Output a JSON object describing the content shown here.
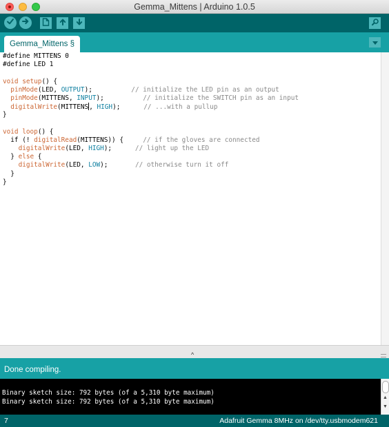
{
  "window": {
    "title": "Gemma_Mittens | Arduino 1.0.5"
  },
  "toolbar": {
    "buttons": [
      "verify-icon",
      "upload-icon",
      "new-icon",
      "open-icon",
      "save-icon",
      "serial-monitor-icon"
    ]
  },
  "tabs": [
    {
      "label": "Gemma_Mittens §"
    }
  ],
  "editor": {
    "lines": [
      [
        {
          "t": "#define MITTENS 0",
          "c": ""
        }
      ],
      [
        {
          "t": "#define LED 1",
          "c": ""
        }
      ],
      [],
      [
        {
          "t": "void",
          "c": "kw"
        },
        {
          "t": " ",
          "c": ""
        },
        {
          "t": "setup",
          "c": "kw"
        },
        {
          "t": "() {",
          "c": ""
        }
      ],
      [
        {
          "t": "  ",
          "c": ""
        },
        {
          "t": "pinMode",
          "c": "kw"
        },
        {
          "t": "(LED, ",
          "c": ""
        },
        {
          "t": "OUTPUT",
          "c": "kb"
        },
        {
          "t": ");          ",
          "c": ""
        },
        {
          "t": "// initialize the LED pin as an output",
          "c": "cm"
        }
      ],
      [
        {
          "t": "  ",
          "c": ""
        },
        {
          "t": "pinMode",
          "c": "kw"
        },
        {
          "t": "(MITTENS, ",
          "c": ""
        },
        {
          "t": "INPUT",
          "c": "kb"
        },
        {
          "t": ");          ",
          "c": ""
        },
        {
          "t": "// initialize the SWITCH pin as an input",
          "c": "cm"
        }
      ],
      [
        {
          "t": "  ",
          "c": ""
        },
        {
          "t": "digitalWrite",
          "c": "kw"
        },
        {
          "t": "(MITTENS",
          "c": ""
        },
        {
          "t": "",
          "c": "caret"
        },
        {
          "t": ", ",
          "c": ""
        },
        {
          "t": "HIGH",
          "c": "kb"
        },
        {
          "t": ");      ",
          "c": ""
        },
        {
          "t": "// ...with a pullup",
          "c": "cm"
        }
      ],
      [
        {
          "t": "}",
          "c": ""
        }
      ],
      [],
      [
        {
          "t": "void",
          "c": "kw"
        },
        {
          "t": " ",
          "c": ""
        },
        {
          "t": "loop",
          "c": "kw"
        },
        {
          "t": "() {",
          "c": ""
        }
      ],
      [
        {
          "t": "  if (! ",
          "c": ""
        },
        {
          "t": "digitalRead",
          "c": "kw"
        },
        {
          "t": "(MITTENS)) {     ",
          "c": ""
        },
        {
          "t": "// if the gloves are connected",
          "c": "cm"
        }
      ],
      [
        {
          "t": "    ",
          "c": ""
        },
        {
          "t": "digitalWrite",
          "c": "kw"
        },
        {
          "t": "(LED, ",
          "c": ""
        },
        {
          "t": "HIGH",
          "c": "kb"
        },
        {
          "t": ");      ",
          "c": ""
        },
        {
          "t": "// light up the LED",
          "c": "cm"
        }
      ],
      [
        {
          "t": "  } ",
          "c": ""
        },
        {
          "t": "else",
          "c": "kw"
        },
        {
          "t": " {",
          "c": ""
        }
      ],
      [
        {
          "t": "    ",
          "c": ""
        },
        {
          "t": "digitalWrite",
          "c": "kw"
        },
        {
          "t": "(LED, ",
          "c": ""
        },
        {
          "t": "LOW",
          "c": "kb"
        },
        {
          "t": ");       ",
          "c": ""
        },
        {
          "t": "// otherwise turn it off",
          "c": "cm"
        }
      ],
      [
        {
          "t": "  }",
          "c": ""
        }
      ],
      [
        {
          "t": "}",
          "c": ""
        }
      ]
    ]
  },
  "status": {
    "message": "Done compiling."
  },
  "console": {
    "lines": [
      "Binary sketch size: 792 bytes (of a 5,310 byte maximum)",
      "Binary sketch size: 792 bytes (of a 5,310 byte maximum)"
    ]
  },
  "footer": {
    "line_number": "7",
    "board": "Adafruit Gemma 8MHz on /dev/tty.usbmodem621"
  },
  "colors": {
    "toolbar": "#006468",
    "tabbar": "#17a1a5",
    "button": "#4db7bb",
    "keyword": "#cc6633",
    "constant": "#0e7fa0",
    "comment": "#8a8a8a"
  }
}
